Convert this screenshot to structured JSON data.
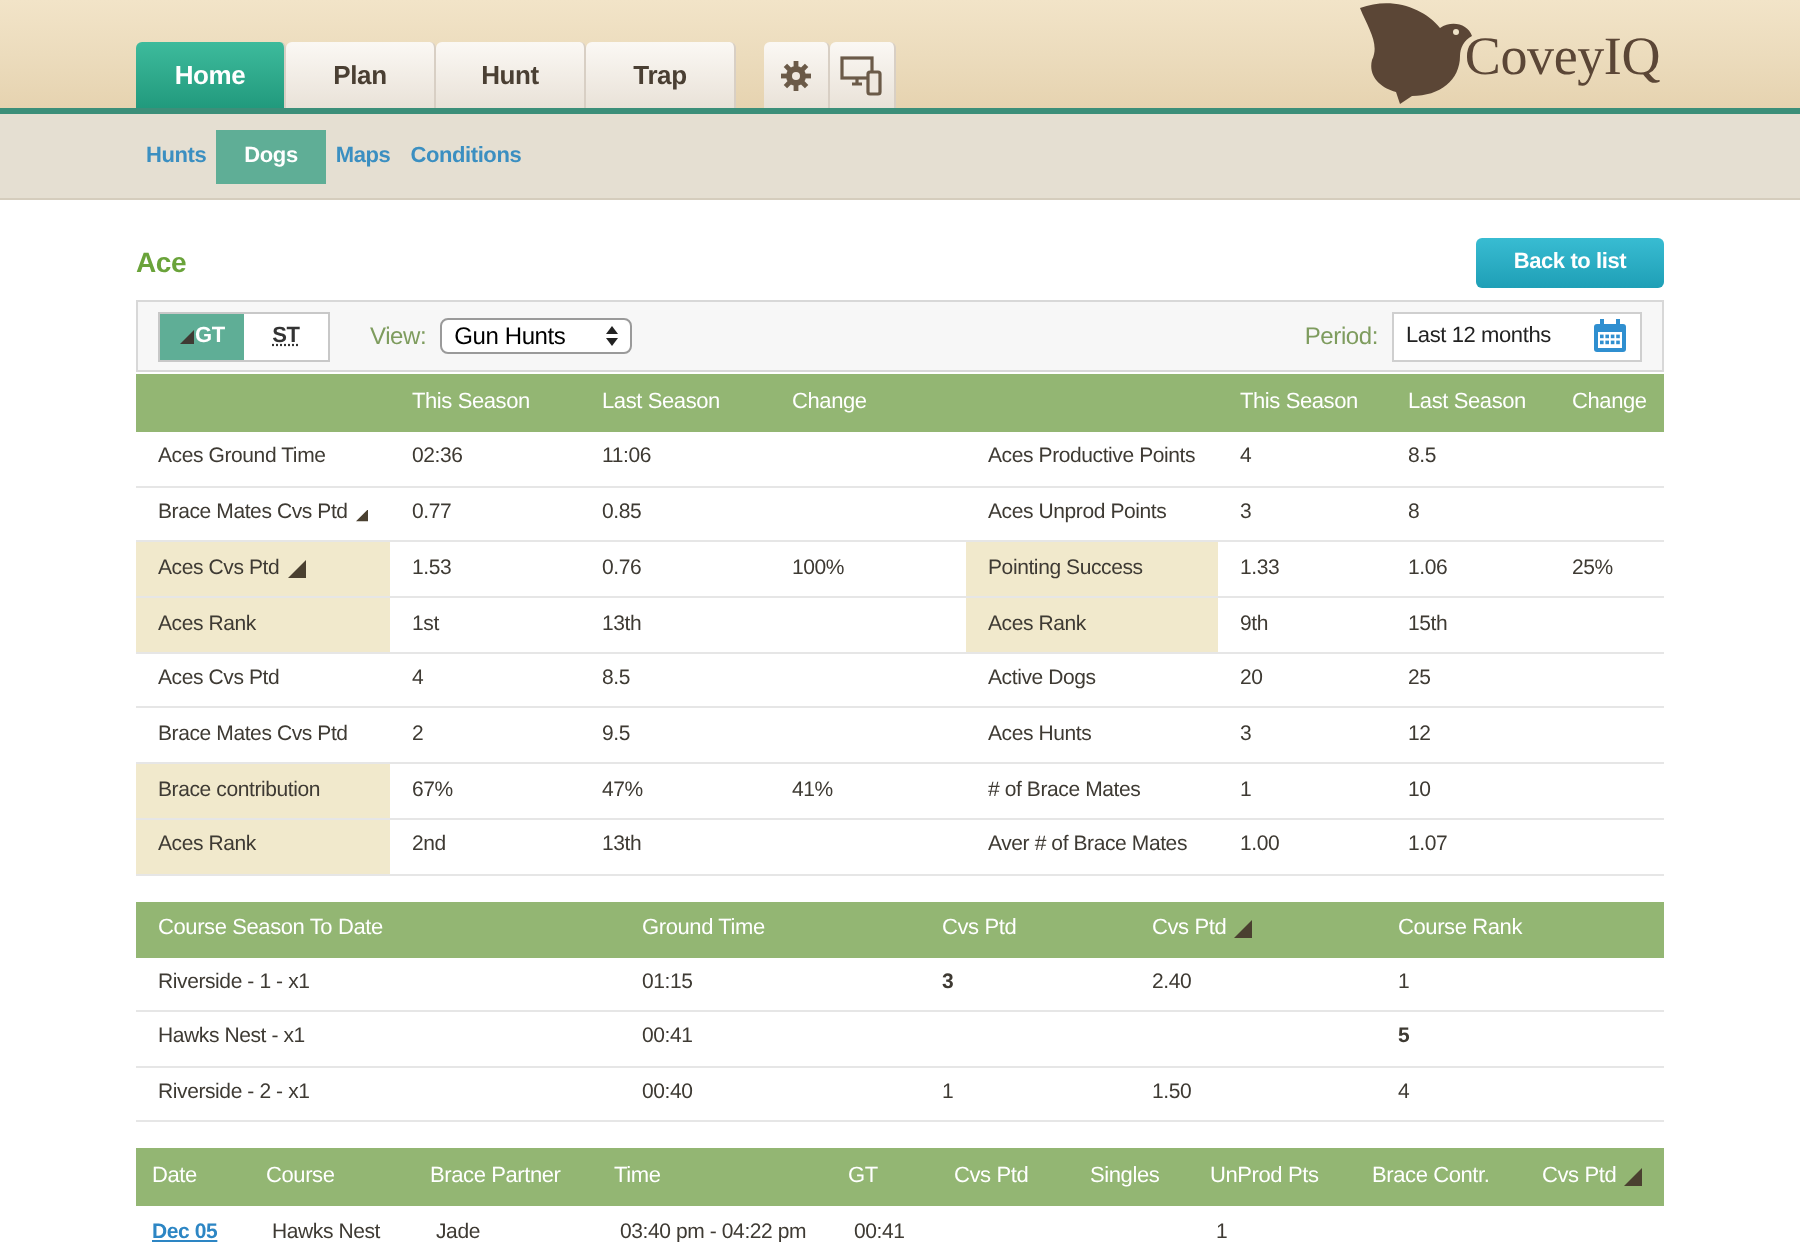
{
  "nav_tabs": [
    {
      "label": "Home",
      "selected": true
    },
    {
      "label": "Plan",
      "selected": false
    },
    {
      "label": "Hunt",
      "selected": false
    },
    {
      "label": "Trap",
      "selected": false
    }
  ],
  "tool_tabs": [
    {
      "kind": "settings"
    },
    {
      "kind": "devices"
    }
  ],
  "logo": {
    "text": "CoveyIQ"
  },
  "sub_nav": [
    {
      "label": "Hunts",
      "selected": false
    },
    {
      "label": "Dogs",
      "selected": true
    },
    {
      "label": "Maps",
      "selected": false
    },
    {
      "label": "Conditions",
      "selected": false
    }
  ],
  "page_title": "Ace",
  "back_button": "Back to list",
  "toolbar": {
    "toggle": [
      {
        "label": "GT",
        "selected": true
      },
      {
        "label": "ST",
        "selected": false
      }
    ],
    "view_label": "View:",
    "view_value": "Gun Hunts",
    "period_label": "Period:",
    "period_value": "Last 12 months"
  },
  "stats": {
    "columns": [
      "This Season",
      "Last Season",
      "Change",
      "This Season",
      "Last Season",
      "Change"
    ],
    "rows": [
      {
        "left": {
          "label": "Aces Ground Time",
          "marker": false,
          "highlighted": false,
          "this": "02:36",
          "last": "11:06"
        },
        "right": {
          "label": "Aces Productive Points",
          "highlighted": false,
          "this": "4",
          "last": "8.5"
        }
      },
      {
        "left": {
          "label": "Brace Mates Cvs Ptd",
          "marker": true,
          "highlighted": false,
          "this": "0.77",
          "last": "0.85"
        },
        "right": {
          "label": "Aces Unprod Points",
          "highlighted": false,
          "this": "3",
          "last": "8"
        }
      },
      {
        "left": {
          "label": "Aces Cvs Ptd",
          "marker": true,
          "highlighted": true,
          "this": "1.53",
          "last": "0.76",
          "change": "100%"
        },
        "right": {
          "label": "Pointing Success",
          "highlighted": true,
          "this": "1.33",
          "last": "1.06",
          "change": "25%"
        }
      },
      {
        "left": {
          "label": "Aces Rank",
          "marker": false,
          "highlighted": true,
          "this": "1st",
          "last": "13th"
        },
        "right": {
          "label": "Aces Rank",
          "highlighted": true,
          "this": "9th",
          "last": "15th"
        }
      },
      {
        "left": {
          "label": "Aces Cvs Ptd",
          "marker": false,
          "highlighted": false,
          "this": "4",
          "last": "8.5"
        },
        "right": {
          "label": "Active Dogs",
          "highlighted": false,
          "this": "20",
          "last": "25"
        }
      },
      {
        "left": {
          "label": "Brace Mates Cvs Ptd",
          "marker": false,
          "highlighted": false,
          "this": "2",
          "last": "9.5"
        },
        "right": {
          "label": "Aces Hunts",
          "highlighted": false,
          "this": "3",
          "last": "12"
        }
      },
      {
        "left": {
          "label": "Brace contribution",
          "marker": false,
          "highlighted": true,
          "this": "67%",
          "last": "47%",
          "change": "41%"
        },
        "right": {
          "label": "# of Brace Mates",
          "highlighted": false,
          "this": "1",
          "last": "10"
        }
      },
      {
        "left": {
          "label": "Aces Rank",
          "marker": false,
          "highlighted": true,
          "this": "2nd",
          "last": "13th"
        },
        "right": {
          "label": "Aver # of Brace Mates",
          "highlighted": false,
          "this": "1.00",
          "last": "1.07"
        }
      }
    ]
  },
  "courses": {
    "columns": [
      {
        "label": "Course Season To Date",
        "marker": false
      },
      {
        "label": "Ground Time",
        "marker": false
      },
      {
        "label": "Cvs Ptd",
        "marker": false
      },
      {
        "label": "Cvs Ptd",
        "marker": true
      },
      {
        "label": "Course Rank",
        "marker": false
      }
    ],
    "rows": [
      {
        "course": {
          "text": "Riverside - 1 - x1",
          "bold": false
        },
        "ground_time": {
          "text": "01:15",
          "bold": false
        },
        "cvs_ptd": {
          "text": "3",
          "bold": true
        },
        "cvs_ptd_2": {
          "text": "2.40",
          "bold": false
        },
        "course_rank": {
          "text": "1",
          "bold": false
        }
      },
      {
        "course": {
          "text": "Hawks Nest - x1",
          "bold": false
        },
        "ground_time": {
          "text": "00:41",
          "bold": false
        },
        "course_rank": {
          "text": "5",
          "bold": true
        }
      },
      {
        "course": {
          "text": "Riverside - 2 - x1",
          "bold": false
        },
        "ground_time": {
          "text": "00:40",
          "bold": false
        },
        "cvs_ptd": {
          "text": "1",
          "bold": false
        },
        "cvs_ptd_2": {
          "text": "1.50",
          "bold": false
        },
        "course_rank": {
          "text": "4",
          "bold": false
        }
      }
    ]
  },
  "hunts": {
    "columns": [
      {
        "label": "Date",
        "marker": false
      },
      {
        "label": "Course",
        "marker": false
      },
      {
        "label": "Brace Partner",
        "marker": false
      },
      {
        "label": "Time",
        "marker": false
      },
      {
        "label": "GT",
        "marker": false
      },
      {
        "label": "Cvs Ptd",
        "marker": false
      },
      {
        "label": "Singles",
        "marker": false
      },
      {
        "label": "UnProd Pts",
        "marker": false
      },
      {
        "label": "Brace Contr.",
        "marker": false
      },
      {
        "label": "Cvs Ptd",
        "marker": true
      }
    ],
    "rows": [
      {
        "date": "Dec 05",
        "course": "Hawks Nest",
        "brace_partner": "Jade",
        "time": "03:40 pm - 04:22 pm",
        "gt": "00:41",
        "unprod_pts": "1"
      }
    ]
  }
}
